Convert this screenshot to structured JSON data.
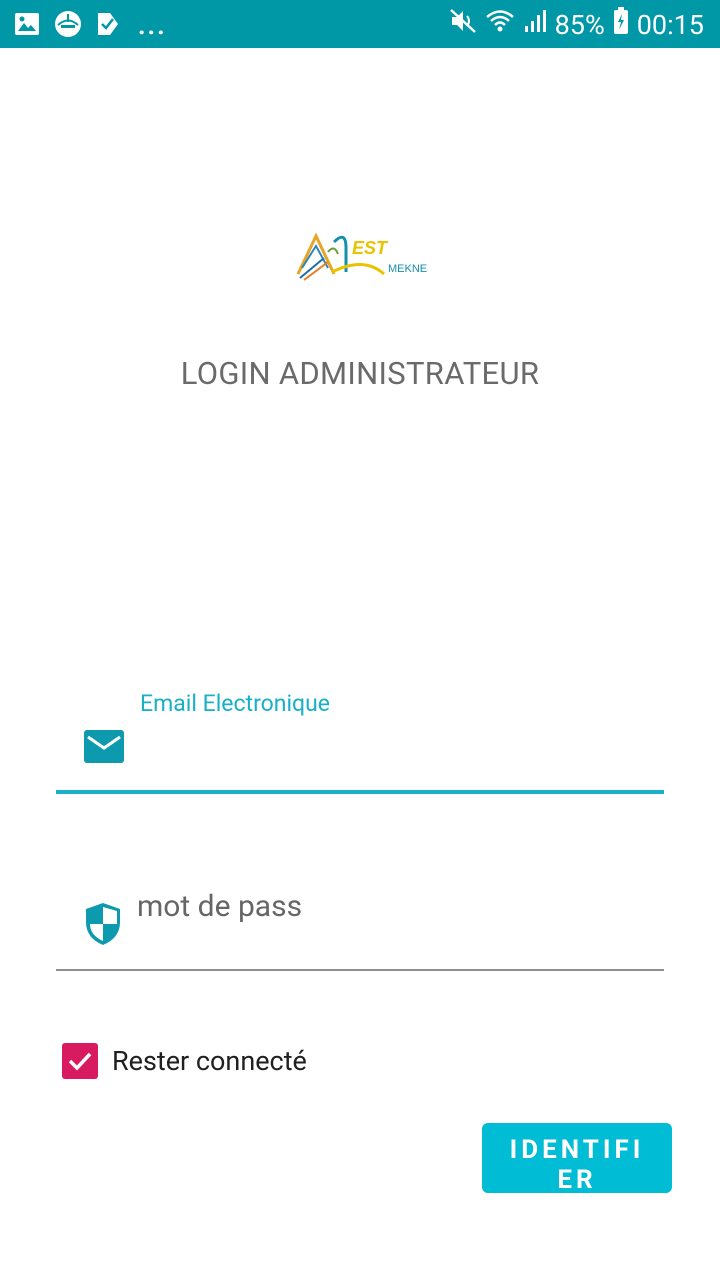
{
  "status_bar": {
    "battery": "85%",
    "time": "00:15",
    "notifications_more": "..."
  },
  "logo": {
    "text": "EST",
    "subtext": "MEKNES"
  },
  "header": {
    "title": "LOGIN ADMINISTRATEUR"
  },
  "form": {
    "email_label": "Email Electronique",
    "email_value": "",
    "password_placeholder": "mot de pass",
    "remember_label": "Rester connecté",
    "remember_checked": true,
    "submit_label": "IDENTIFIER"
  },
  "colors": {
    "status_bar": "#0097A7",
    "accent": "#18B0C6",
    "checkbox": "#D81B60",
    "button": "#00BCD4"
  }
}
